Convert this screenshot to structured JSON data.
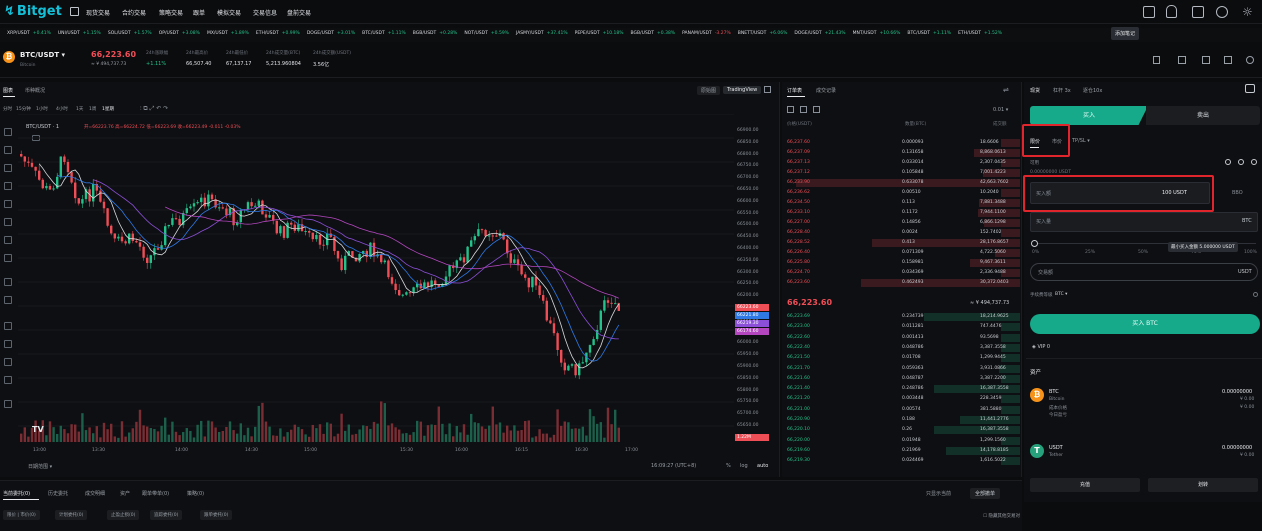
{
  "brand": {
    "name": "Bitget"
  },
  "nav": [
    "现货交易",
    "合约交易",
    "策略交易",
    "跟单",
    "模拟交易",
    "交易信息",
    "盘前交易"
  ],
  "tooltip": "添加笔记",
  "ticker": [
    {
      "sym": "XRP/USDT",
      "chg": "+0.41%",
      "up": true
    },
    {
      "sym": "UNI/USDT",
      "chg": "+1.15%",
      "up": true
    },
    {
      "sym": "SOL/USDT",
      "chg": "+1.57%",
      "up": true
    },
    {
      "sym": "OP/USDT",
      "chg": "+3.08%",
      "up": true
    },
    {
      "sym": "MX/USDT",
      "chg": "+1.89%",
      "up": true
    },
    {
      "sym": "ETH/USDT",
      "chg": "+0.99%",
      "up": true
    },
    {
      "sym": "DOGE/USDT",
      "chg": "+3.01%",
      "up": true
    },
    {
      "sym": "BTC/USDT",
      "chg": "+1.11%",
      "up": true
    },
    {
      "sym": "BGB/USDT",
      "chg": "+0.28%",
      "up": true
    },
    {
      "sym": "NOT/USDT",
      "chg": "+0.59%",
      "up": true
    },
    {
      "sym": "JASMY/USDT",
      "chg": "+37.41%",
      "up": true
    },
    {
      "sym": "PEPE/USDT",
      "chg": "+10.18%",
      "up": true
    },
    {
      "sym": "BGB/USDT",
      "chg": "+0.38%",
      "up": true
    },
    {
      "sym": "PANAM/USDT",
      "chg": "-3.27%",
      "up": false
    },
    {
      "sym": "BNETT/USDT",
      "chg": "+6.06%",
      "up": true
    },
    {
      "sym": "DOGE/USDT",
      "chg": "+21.43%",
      "up": true
    },
    {
      "sym": "MNT/USDT",
      "chg": "+10.66%",
      "up": true
    },
    {
      "sym": "BTC/USDT",
      "chg": "+1.11%",
      "up": true
    },
    {
      "sym": "ETH/USDT",
      "chg": "+1.52%",
      "up": true
    }
  ],
  "pair": {
    "name": "BTC/USDT",
    "sub": "Bitcoin",
    "price": "66,223.60",
    "approx": "≈ ¥ 494,737.73"
  },
  "stats": [
    {
      "label": "24h涨跌幅",
      "value": "+1.11%",
      "color": "#23c28a"
    },
    {
      "label": "24h最高价",
      "value": "66,507.40",
      "color": "#dfe2e6"
    },
    {
      "label": "24h最低价",
      "value": "67,137.17",
      "color": "#dfe2e6"
    },
    {
      "label": "24h成交量(BTC)",
      "value": "5,213.960804",
      "color": "#dfe2e6"
    },
    {
      "label": "24h成交额(USDT)",
      "value": "3.56亿",
      "color": "#dfe2e6"
    }
  ],
  "chart": {
    "tabs": [
      "图表",
      "币种概况"
    ],
    "views": [
      "原始图",
      "TradingView"
    ],
    "intervals": [
      "分时",
      "15分钟",
      "1小时",
      "4小时",
      "1天",
      "1周",
      "1星期"
    ],
    "legend": "BTC/USDT · 1",
    "ohlc": "开=66223.76 高=66224.72 低=66223.69 收=66223.49 -0.011 -0.03%",
    "price_axis": [
      "66900.00",
      "66850.00",
      "66800.00",
      "66750.00",
      "66700.00",
      "66650.00",
      "66600.00",
      "66550.00",
      "66500.00",
      "66450.00",
      "66400.00",
      "66350.00",
      "66300.00",
      "66250.00",
      "66200.00",
      "66150.00",
      "66100.00",
      "66050.00",
      "66000.00",
      "65950.00",
      "65900.00",
      "65850.00",
      "65800.00",
      "65750.00",
      "65700.00",
      "65650.00"
    ],
    "price_tags": [
      {
        "text": "66223.60",
        "color": "#ef4e57"
      },
      {
        "text": "66221.80",
        "color": "#2e79e6"
      },
      {
        "text": "66219.30",
        "color": "#8b4fd8"
      },
      {
        "text": "66174.60",
        "color": "#b447c0"
      }
    ],
    "vol_tag": "1.22M",
    "time_axis": [
      "13:00",
      "13:30",
      "14:00",
      "14:30",
      "15:00",
      "15:30",
      "16:00",
      "16:15",
      "16:30",
      "17:00"
    ],
    "time_label": "16:09:27 (UTC+8)",
    "range_btn": "日期范围",
    "pct": "%",
    "log": "log",
    "auto": "auto"
  },
  "orderbook": {
    "tabs": [
      "订单表",
      "成交记录"
    ],
    "precision": "0.01",
    "headers": [
      "价格(USDT)",
      "数量(BTC)",
      "成交额"
    ],
    "asks": [
      [
        "66,237.60",
        "0.000093",
        "18.6606"
      ],
      [
        "66,237.09",
        "0.131658",
        "8,868.0613"
      ],
      [
        "66,237.13",
        "0.033014",
        "2,307.0435"
      ],
      [
        "66,237.12",
        "0.105848",
        "7,001.4223"
      ],
      [
        "66,233.90",
        "0.633078",
        "42,663.7602"
      ],
      [
        "66,236.62",
        "0.00510",
        "10.2040"
      ],
      [
        "66,234.50",
        "0.113",
        "7,881.3488"
      ],
      [
        "66,233.10",
        "0.1172",
        "7,944.1100"
      ],
      [
        "66,227.00",
        "0.14856",
        "6,866.1298"
      ],
      [
        "66,228.40",
        "0.0024",
        "152.7402"
      ],
      [
        "66,228.52",
        "0.413",
        "28,176.8657"
      ],
      [
        "66,226.40",
        "0.071309",
        "4,722.5060"
      ],
      [
        "66,225.80",
        "0.158981",
        "9,467.3611"
      ],
      [
        "66,224.70",
        "0.034369",
        "2,336.9488"
      ],
      [
        "66,223.60",
        "0.462493",
        "30,372.0403"
      ]
    ],
    "mid_price": "66,223.60",
    "mid_approx": "≈ ¥ 494,737.73",
    "bids": [
      [
        "66,223.69",
        "0.234739",
        "18,214.9625"
      ],
      [
        "66,223.00",
        "0.011281",
        "747.4476"
      ],
      [
        "66,222.60",
        "0.001413",
        "93.5698"
      ],
      [
        "66,222.40",
        "0.048786",
        "3,387.3558"
      ],
      [
        "66,221.50",
        "0.01708",
        "1,299.9445"
      ],
      [
        "66,221.70",
        "0.059363",
        "3,931.0866"
      ],
      [
        "66,221.60",
        "0.048787",
        "3,387.2200"
      ],
      [
        "66,221.40",
        "0.248786",
        "16,387.3558"
      ],
      [
        "66,221.20",
        "0.003448",
        "228.3459"
      ],
      [
        "66,221.00",
        "0.00574",
        "381.5880"
      ],
      [
        "66,220.90",
        "0.188",
        "11,441.2776"
      ],
      [
        "66,220.10",
        "0.26",
        "16,387.3558"
      ],
      [
        "66,220.00",
        "0.01948",
        "1,299.1560"
      ],
      [
        "66,219.60",
        "0.21969",
        "14,178.8185"
      ],
      [
        "66,219.30",
        "0.024469",
        "1,616.5022"
      ]
    ]
  },
  "trade": {
    "tabs": [
      "现货",
      "杠杆 3x",
      "逐仓10x"
    ],
    "buy_label": "买入",
    "sell_label": "卖出",
    "order_types": [
      "限价",
      "市价",
      "TP/SL"
    ],
    "avail_label": "可用",
    "avail_value": "0.00000000 USDT",
    "buy_amount_label": "买入额",
    "buy_amount_value": "100 USDT",
    "bbo": "BBO",
    "buy_qty_label": "买入量",
    "buy_qty_unit": "BTC",
    "slider_marks": [
      "0%",
      "25%",
      "50%",
      "75%",
      "100%"
    ],
    "min_tip": "最小买入金额 5.000000 USDT",
    "total_label": "交易额",
    "total_unit": "USDT",
    "fee_label": "手续费等级",
    "fee_value": "BTC",
    "submit": "买入 BTC",
    "vip": "VIP 0",
    "assets_title": "资产",
    "assets": [
      {
        "sym": "BTC",
        "name": "Bitcoin",
        "total": "0.00000000",
        "r1_label": "成本价格",
        "r1_val": "¥ 0.00",
        "r2_label": "今日盈亏",
        "r2_val": "¥ 0.00",
        "color": "#f7931a",
        "glyph": "₿"
      },
      {
        "sym": "USDT",
        "name": "Tether",
        "total": "0.00000000",
        "r1_label": "",
        "r1_val": "¥ 0.00",
        "r2_label": "",
        "r2_val": "",
        "color": "#26a17b",
        "glyph": "T"
      }
    ],
    "deposit": "充值",
    "transfer": "划转"
  },
  "bottom": {
    "tabs": [
      "当前委托(0)",
      "历史委托",
      "成交明细",
      "资产",
      "跟单带单(0)",
      "策略(0)"
    ],
    "filters": [
      "限价 | 市价(0)",
      "计划委托(0)",
      "止盈止损(0)",
      "追踪委托(0)",
      "跟单委托(0)"
    ],
    "right_label": "只显示当前",
    "right_btn": "全部撤单",
    "hide_label": "隐藏其他交易对"
  }
}
